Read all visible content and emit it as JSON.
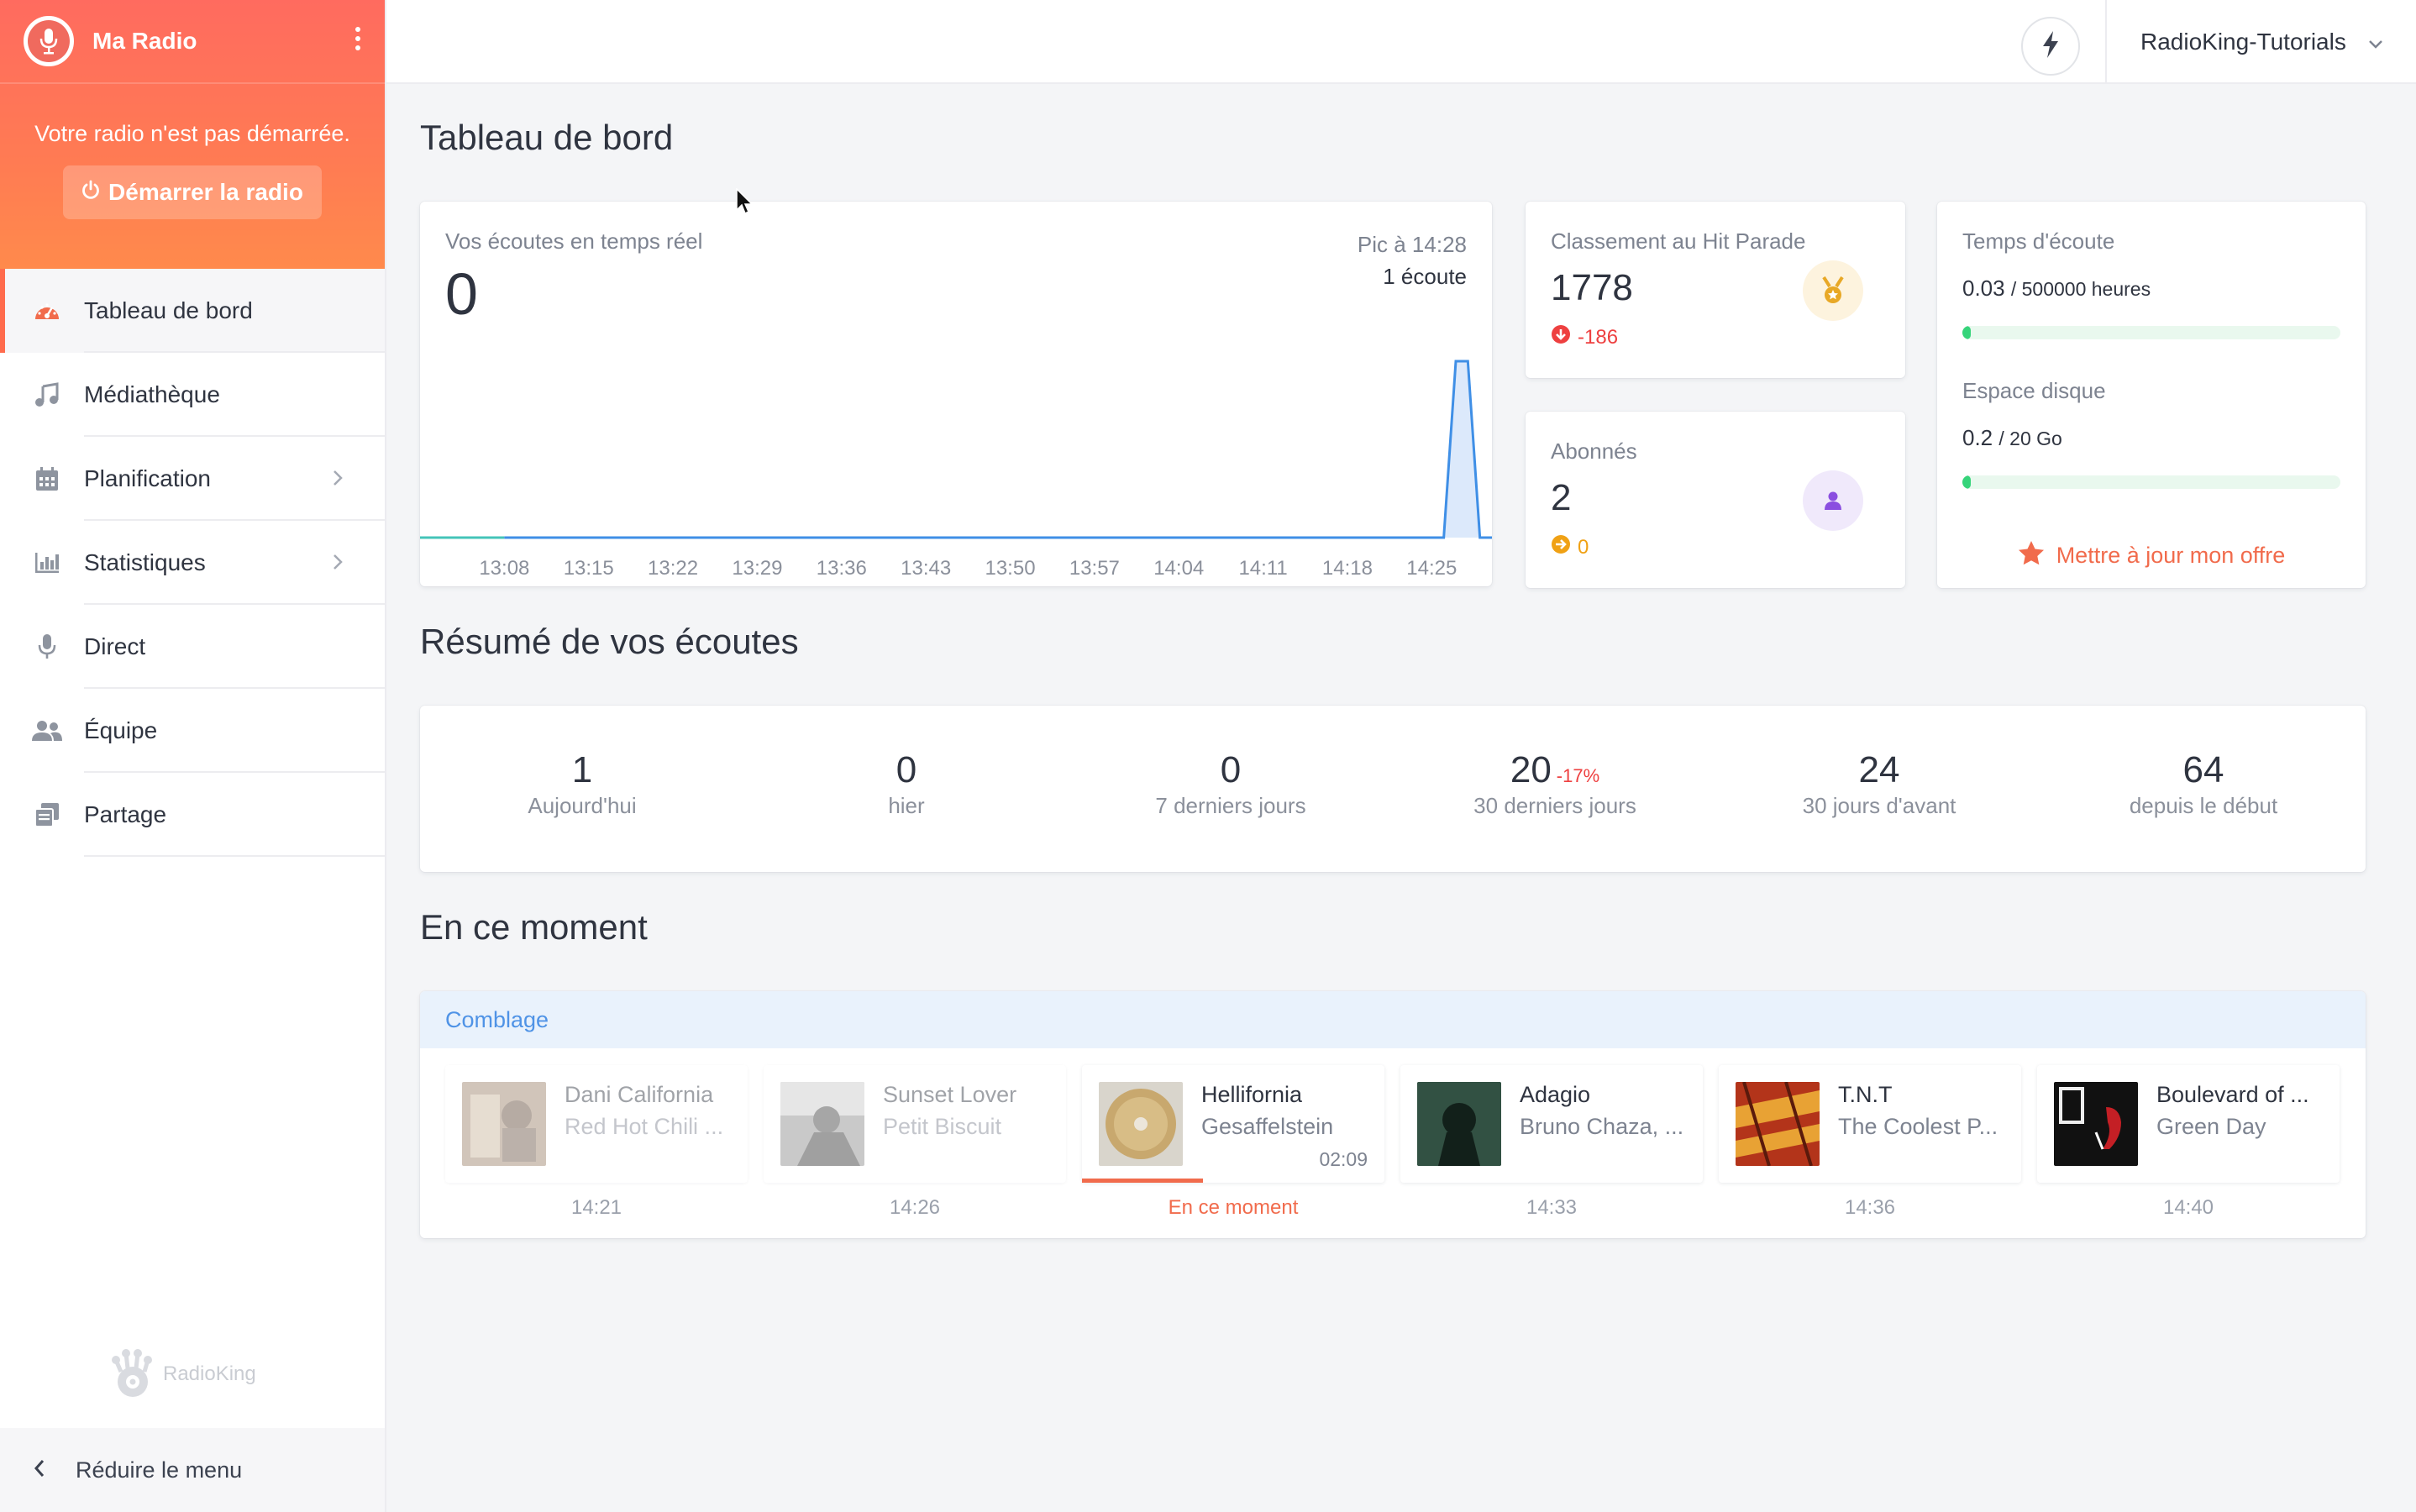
{
  "sidebar": {
    "radio_name": "Ma Radio",
    "status_text": "Votre radio n'est pas démarrée.",
    "start_button": "Démarrer la radio",
    "items": [
      {
        "label": "Tableau de bord",
        "icon": "dashboard-icon",
        "active": true
      },
      {
        "label": "Médiathèque",
        "icon": "music-note-icon"
      },
      {
        "label": "Planification",
        "icon": "calendar-icon",
        "has_submenu": true
      },
      {
        "label": "Statistiques",
        "icon": "bar-chart-icon",
        "has_submenu": true
      },
      {
        "label": "Direct",
        "icon": "microphone-icon"
      },
      {
        "label": "Équipe",
        "icon": "team-icon"
      },
      {
        "label": "Partage",
        "icon": "share-icon"
      }
    ],
    "logo_text": "RadioKing",
    "collapse_label": "Réduire le menu"
  },
  "topbar": {
    "account_name": "RadioKing-Tutorials"
  },
  "dashboard": {
    "title": "Tableau de bord",
    "realtime": {
      "label": "Vos écoutes en temps réel",
      "value": "0",
      "peak_label": "Pic à 14:28",
      "peak_value": "1 écoute"
    },
    "hit_parade": {
      "label": "Classement au Hit Parade",
      "value": "1778",
      "delta": "-186"
    },
    "subscribers": {
      "label": "Abonnés",
      "value": "2",
      "delta": "0"
    },
    "listening_time": {
      "label": "Temps d'écoute",
      "value": "0.03",
      "max": "/ 500000 heures",
      "fraction": 1e-07
    },
    "disk_space": {
      "label": "Espace disque",
      "value": "0.2",
      "max": "/ 20 Go",
      "fraction": 0.01
    },
    "upgrade_label": "Mettre à jour mon offre"
  },
  "summary": {
    "title": "Résumé de vos écoutes",
    "items": [
      {
        "value": "1",
        "label": "Aujourd'hui"
      },
      {
        "value": "0",
        "label": "hier"
      },
      {
        "value": "0",
        "label": "7 derniers jours"
      },
      {
        "value": "20",
        "pct": "-17%",
        "label": "30 derniers jours"
      },
      {
        "value": "24",
        "label": "30 jours d'avant"
      },
      {
        "value": "64",
        "label": "depuis le début"
      }
    ]
  },
  "now_playing": {
    "title": "En ce moment",
    "playlist": "Comblage",
    "tracks": [
      {
        "title": "Dani California",
        "artist": "Red Hot Chili ...",
        "time": "14:21",
        "state": "past",
        "cover_color": "#8a6f5a"
      },
      {
        "title": "Sunset Lover",
        "artist": "Petit Biscuit",
        "time": "14:26",
        "state": "past",
        "cover_color": "#6f6f6f"
      },
      {
        "title": "Hellifornia",
        "artist": "Gesaffelstein",
        "duration": "02:09",
        "time": "En ce moment",
        "state": "current",
        "progress": 0.4,
        "cover_color": "#b9a178"
      },
      {
        "title": "Adagio",
        "artist": "Bruno Chaza, ...",
        "time": "14:33",
        "state": "upcoming",
        "cover_color": "#2d4a3b"
      },
      {
        "title": "T.N.T",
        "artist": "The Coolest P...",
        "time": "14:36",
        "state": "upcoming",
        "cover_color": "#c23b1c"
      },
      {
        "title": "Boulevard of ...",
        "artist": "Green Day",
        "time": "14:40",
        "state": "upcoming",
        "cover_color": "#111111"
      }
    ]
  },
  "chart_data": {
    "type": "area",
    "title": "Vos écoutes en temps réel",
    "x": [
      "13:08",
      "13:15",
      "13:22",
      "13:29",
      "13:36",
      "13:43",
      "13:50",
      "13:57",
      "14:04",
      "14:11",
      "14:18",
      "14:25",
      "14:26",
      "14:27",
      "14:28",
      "14:29"
    ],
    "x_tick_labels": [
      "13:08",
      "13:15",
      "13:22",
      "13:29",
      "13:36",
      "13:43",
      "13:50",
      "13:57",
      "14:04",
      "14:11",
      "14:18",
      "14:25"
    ],
    "values": [
      0,
      0,
      0,
      0,
      0,
      0,
      0,
      0,
      0,
      0,
      0,
      0,
      0,
      1,
      1,
      0
    ],
    "ylim": [
      0,
      1
    ],
    "grid": false,
    "legend": "none",
    "color": "#3f8fe6"
  }
}
